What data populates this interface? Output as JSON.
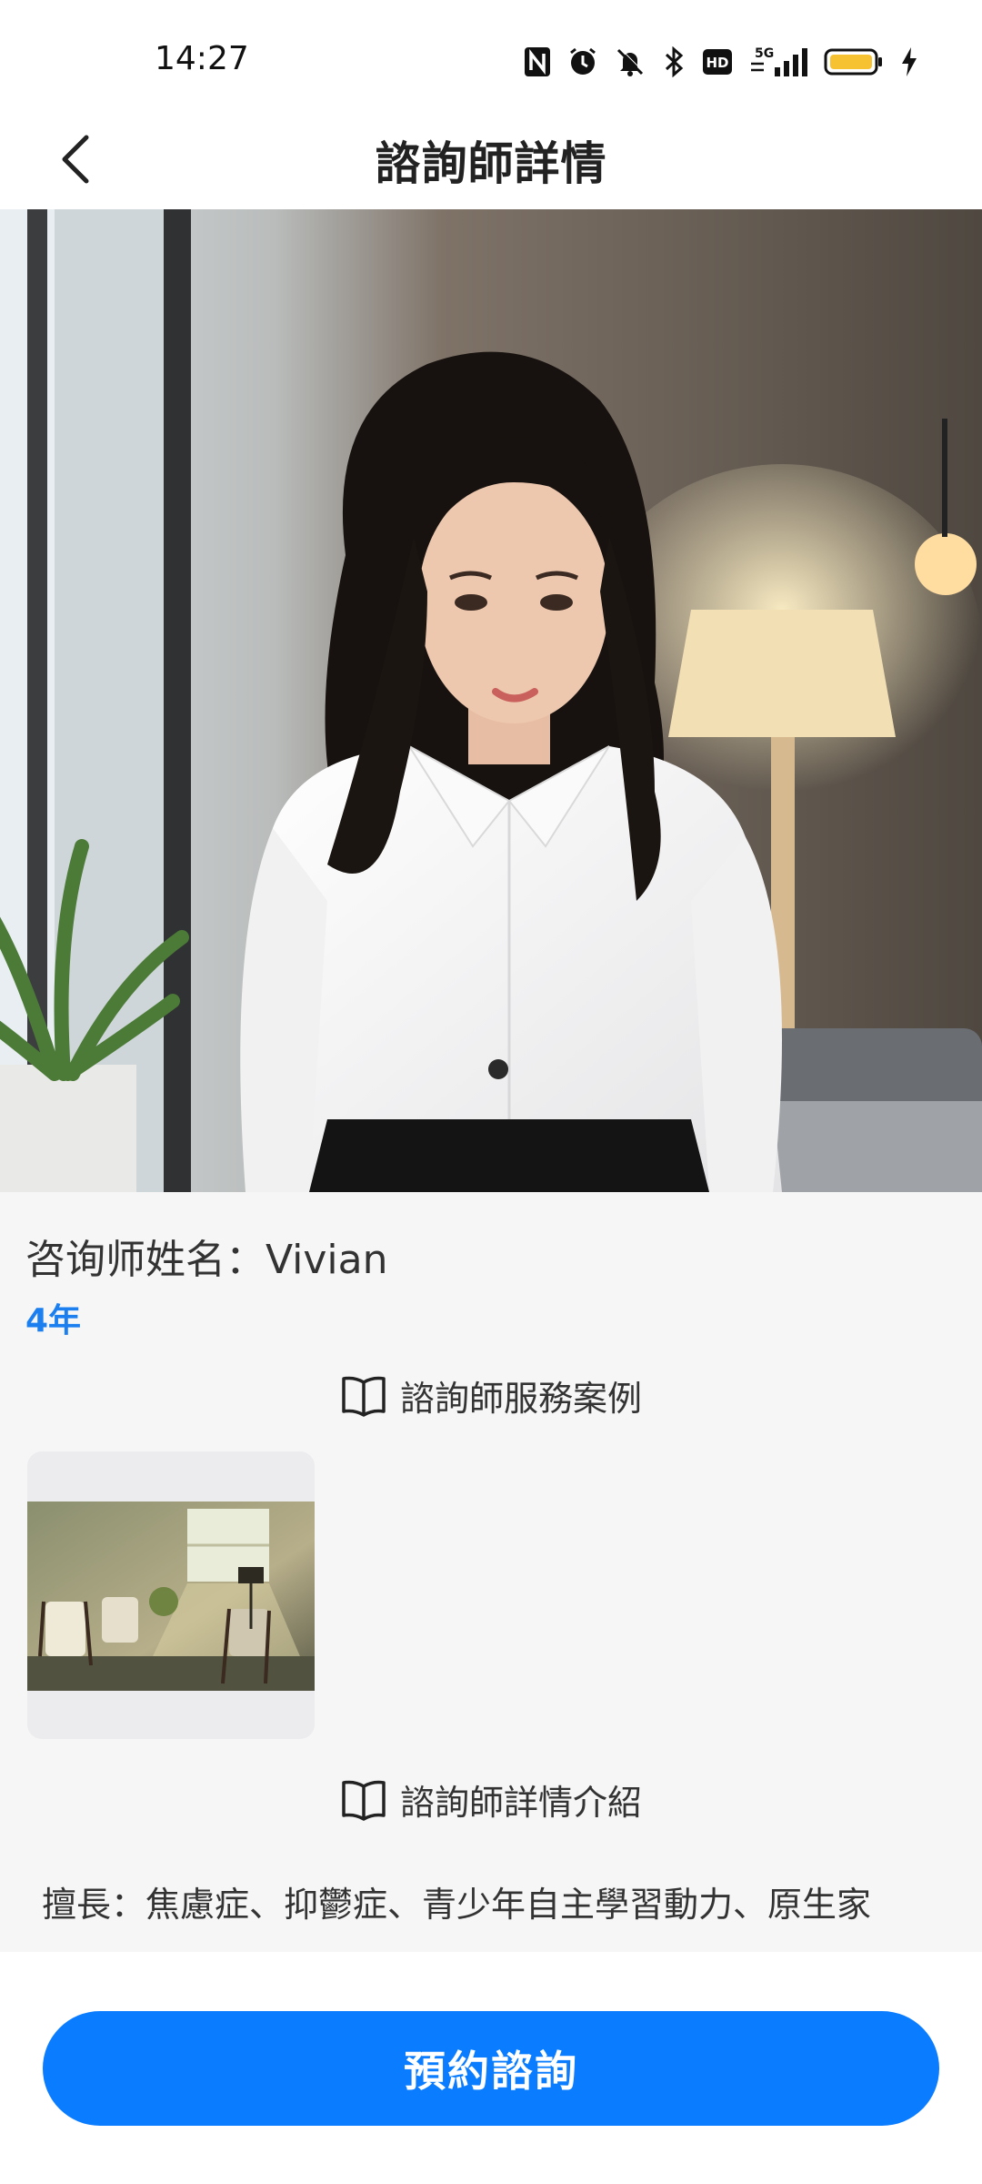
{
  "status_bar": {
    "time": "14:27",
    "icons": [
      "nfc-icon",
      "alarm-icon",
      "mute-icon",
      "bluetooth-icon",
      "hd-icon",
      "signal-5g-icon",
      "battery-icon",
      "charging-icon"
    ],
    "hd_label": "HD",
    "network_label": "5G"
  },
  "header": {
    "title": "諮詢師詳情",
    "back_icon": "chevron-left-icon"
  },
  "profile": {
    "name_label": "咨询师姓名：",
    "name": "Vivian",
    "years": "4年"
  },
  "cases": {
    "heading": "諮詢師服務案例",
    "icon": "book-icon"
  },
  "intro": {
    "heading": "諮詢師詳情介紹",
    "icon": "book-icon",
    "specialty": "擅長：焦慮症、抑鬱症、青少年自主學習動力、原生家"
  },
  "footer": {
    "book_button_label": "預約諮詢"
  },
  "colors": {
    "accent": "#0a7cff",
    "years_text": "#1b7ff0",
    "background": "#f6f6f6"
  }
}
